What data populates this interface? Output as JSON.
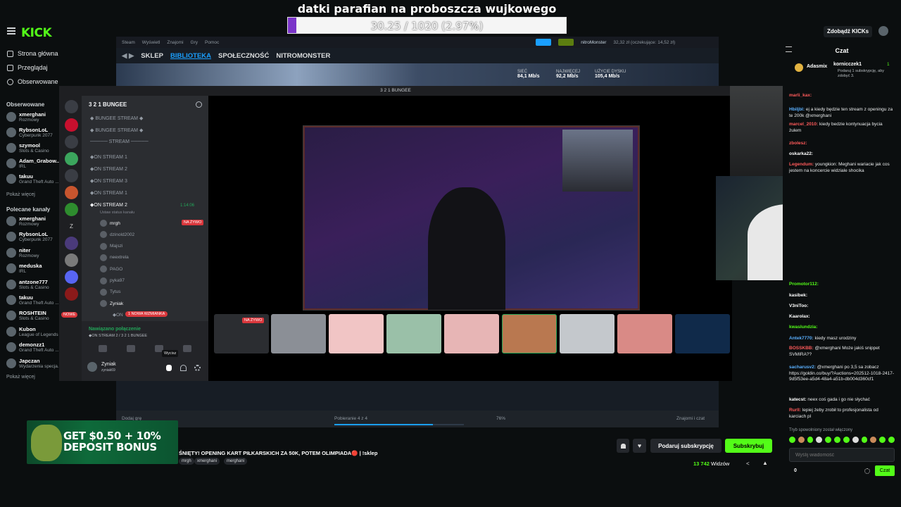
{
  "banner": {
    "title": "datki parafian na proboszcza wujkowego",
    "progress": "30.25 / 1020 (2.97%)",
    "progress_fraction": 0.0297
  },
  "kick_nav": {
    "logo": "KICK",
    "items": [
      "Strona główna",
      "Przeglądaj",
      "Obserwowane"
    ],
    "followed_title": "Obserwowane",
    "followed": [
      [
        "xmerghani",
        "Rozmowy"
      ],
      [
        "RybsonLoL",
        "Cyberpunk 2077"
      ],
      [
        "szymool",
        "Slots & Casino"
      ],
      [
        "Adam_Grabow...",
        "IRL"
      ],
      [
        "takuu",
        "Grand Theft Auto ..."
      ]
    ],
    "show_more": "Pokaż więcej",
    "recommended_title": "Polecane kanały",
    "recommended": [
      [
        "xmerghani",
        "Rozmowy"
      ],
      [
        "RybsonLoL",
        "Cyberpunk 2077"
      ],
      [
        "niter",
        "Rozmowy"
      ],
      [
        "meduska",
        "IRL"
      ],
      [
        "antzone777",
        "Slots & Casino"
      ],
      [
        "takuu",
        "Grand Theft Auto ..."
      ],
      [
        "ROSHTEIN",
        "Slots & Casino"
      ],
      [
        "Kubon",
        "League of Legends"
      ],
      [
        "demonzz1",
        "Grand Theft Auto ..."
      ],
      [
        "Japczan",
        "Wydarzenia specja..."
      ]
    ],
    "show_more2": "Pokaż więcej"
  },
  "steam": {
    "menu": [
      "Steam",
      "Wyświetl",
      "Znajomi",
      "Gry",
      "Pomoc"
    ],
    "tabs": [
      "SKLEP",
      "BIBLIOTEKA",
      "SPOŁECZNOŚĆ",
      "NITROMONSTER"
    ],
    "user": "nitroMonster",
    "wallet": "32,32 zł (oczekujące: 14,52 zł)",
    "stats": [
      {
        "label": "SIEĆ",
        "value": "84,1 Mb/s"
      },
      {
        "label": "NAJWIĘCEJ",
        "value": "92,2 Mb/s"
      },
      {
        "label": "UŻYCIE DYSKU",
        "value": "105,4 Mb/s"
      }
    ],
    "add_game": "Dodaj grę",
    "download": "Pobieranie 4 z 4",
    "download_pct": "76%",
    "download_fraction": 0.76,
    "friends": "Znajomi i czat"
  },
  "discord": {
    "title": "3 2 1 BUNGEE",
    "server": "3 2 1 BUNGEE",
    "channels": [
      "◆ BUNGEE STREAM ◆",
      "◆ BUNGEE STREAM ◆",
      "───── STREAM ─────",
      "◆ON STREAM 1",
      "◆ON STREAM 2",
      "◆ON STREAM 3",
      "◆ON STREAM 1",
      "◆ON STREAM 2"
    ],
    "active_time": "1:14:06",
    "status_hint": "Ustaw status kanału",
    "members": [
      "mrgh",
      "dzinold2002",
      "Majszi",
      "neextrela",
      "PAGO",
      "pyka97",
      "Tytus",
      "Zyniak"
    ],
    "live_badge": "NA ŻYWO",
    "mention": "1 NOWA WZMIANKA",
    "new_badge": "NOWE",
    "last_channel": "◆ON",
    "voice_status": "Nawiązano połączenie",
    "voice_sub": "◆ON STREAM 2 / 3 2 1 BUNGEE",
    "tooltip": "Wycisz",
    "user_name": "Zyniak",
    "user_tag": "zyniak69",
    "server_badges": [
      "10K+",
      "1",
      "2",
      "2",
      "26",
      "1",
      "30",
      "23"
    ]
  },
  "chat": {
    "title": "Czat",
    "header": "Zdobądź KICKs",
    "gifter": "Adasmix",
    "gift_user": "kornicczek1",
    "gift_count": "1",
    "gift_text": "Podaruj 1 subskrypcję, aby zdobyć 3.",
    "messages": [
      {
        "u": "marli_kax:",
        "c": "#ff5a5a",
        "t": ""
      },
      {
        "u": "Hbiljbl:",
        "c": "#5ab0ff",
        "t": "ej a kiedy będzie ten stream z openingu za te 200k @xmerghani"
      },
      {
        "u": "marcel_2010:",
        "c": "#ff5a5a",
        "t": "kiedy bedzie kontynuacja bycia żulem"
      },
      {
        "u": "zbolesz:",
        "c": "#ff5a5a",
        "t": ""
      },
      {
        "u": "oskarka22:",
        "c": "#ffffff",
        "t": ""
      },
      {
        "u": "Legendum:",
        "c": "#ff5a5a",
        "t": "youngkion: Meghani wariacie jak cos jestem na koncercie widzialе shocika"
      },
      {
        "u": "Promotor112:",
        "c": "#53fc18",
        "t": ""
      },
      {
        "u": "kasibek:",
        "c": "#ffffff",
        "t": ""
      },
      {
        "u": "V3niToo:",
        "c": "#ffffff",
        "t": ""
      },
      {
        "u": "Kaarolax:",
        "c": "#ffffff",
        "t": ""
      },
      {
        "u": "kwaslundzia:",
        "c": "#53fc18",
        "t": ""
      },
      {
        "u": "Antek7770:",
        "c": "#5ab0ff",
        "t": "kiedy masz urodziny"
      },
      {
        "u": "BOSSKBB:",
        "c": "#ff5a5a",
        "t": "@xmerghani Może jakiś snippet SVMIRA??"
      },
      {
        "u": "sacharusv2:",
        "c": "#5ab0ff",
        "t": "@xmerghani po 3,5 sa zobacz https://goldin.co/buy/?Auctions=202512-1018-2417-9d5f53ee-a5d4-48a4-a51b-db004d360cf1"
      },
      {
        "u": "katecst:",
        "c": "#ffffff",
        "t": "neex coś gada i go nie słychać"
      },
      {
        "u": "Rurll:",
        "c": "#ff5a5a",
        "t": "lepiej żeby zrobił to profesjonalista od karciach pl"
      }
    ],
    "slow_mode": "Tryb spowolniony został włączony",
    "input_placeholder": "Wyślij wiadomość",
    "points": "0",
    "send_label": "Czat"
  },
  "stream": {
    "title": "ŚNIĘTY! OPENING KART PIŁKARSKICH ZA 50K, POTEM OLIMPIADA🔴 | !sklep",
    "tags": [
      "mrgh",
      "xmerghani",
      "merghani"
    ],
    "sub_gift": "Podaruj subskrypcję",
    "subscribe": "Subskrybuj",
    "viewers": "13 742",
    "viewers_label": "Widzów",
    "ad_text1": "GET $0.50 + 10%",
    "ad_text2": "DEPOSIT BONUS"
  }
}
